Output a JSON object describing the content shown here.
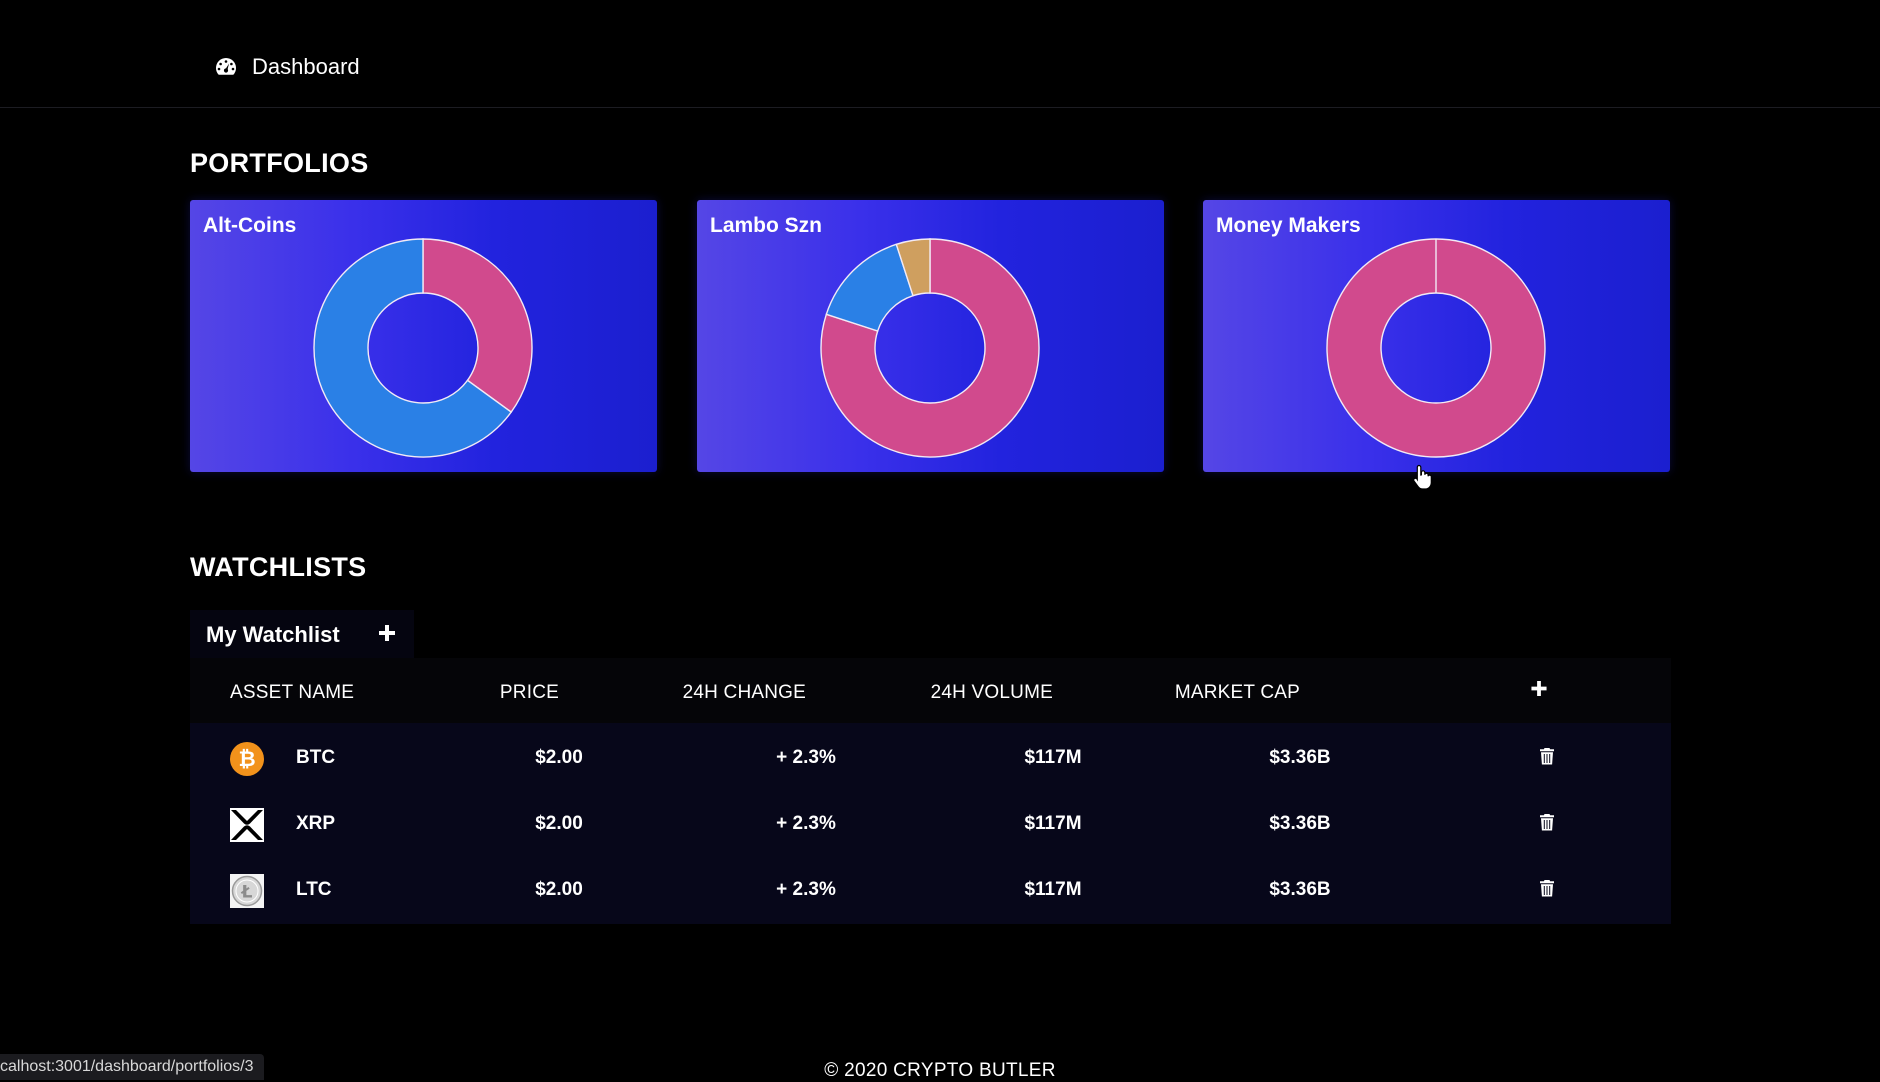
{
  "nav": {
    "dashboard_label": "Dashboard",
    "icon": "tachometer-icon"
  },
  "sections": {
    "portfolios": "PORTFOLIOS",
    "watchlists": "WATCHLISTS"
  },
  "portfolios": [
    {
      "name": "Alt-Coins",
      "segments": [
        {
          "color": "#d14a8d",
          "value": 0.35
        },
        {
          "color": "#2a80e6",
          "value": 0.65
        }
      ]
    },
    {
      "name": "Lambo Szn",
      "segments": [
        {
          "color": "#d14a8d",
          "value": 0.8
        },
        {
          "color": "#2a80e6",
          "value": 0.15
        },
        {
          "color": "#cf9f5f",
          "value": 0.05
        }
      ]
    },
    {
      "name": "Money Makers",
      "segments": [
        {
          "color": "#d14a8d",
          "value": 1.0
        }
      ]
    }
  ],
  "watchlist": {
    "tab_label": "My Watchlist",
    "headers": {
      "name": "ASSET NAME",
      "price": "PRICE",
      "change": "24H CHANGE",
      "volume": "24H VOLUME",
      "cap": "MARKET CAP"
    },
    "rows": [
      {
        "symbol": "BTC",
        "icon": "bitcoin-icon",
        "price": "$2.00",
        "change": "+ 2.3%",
        "volume": "$117M",
        "cap": "$3.36B"
      },
      {
        "symbol": "XRP",
        "icon": "xrp-icon",
        "price": "$2.00",
        "change": "+ 2.3%",
        "volume": "$117M",
        "cap": "$3.36B"
      },
      {
        "symbol": "LTC",
        "icon": "litecoin-icon",
        "price": "$2.00",
        "change": "+ 2.3%",
        "volume": "$117M",
        "cap": "$3.36B"
      }
    ]
  },
  "footer": "© 2020 CRYPTO BUTLER",
  "status_url": "calhost:3001/dashboard/portfolios/3",
  "colors": {
    "background": "#000000",
    "card_gradient_start": "#5546e6",
    "card_gradient_end": "#1b1fcf",
    "slice_pink": "#d14a8d",
    "slice_blue": "#2a80e6",
    "slice_gold": "#cf9f5f"
  }
}
